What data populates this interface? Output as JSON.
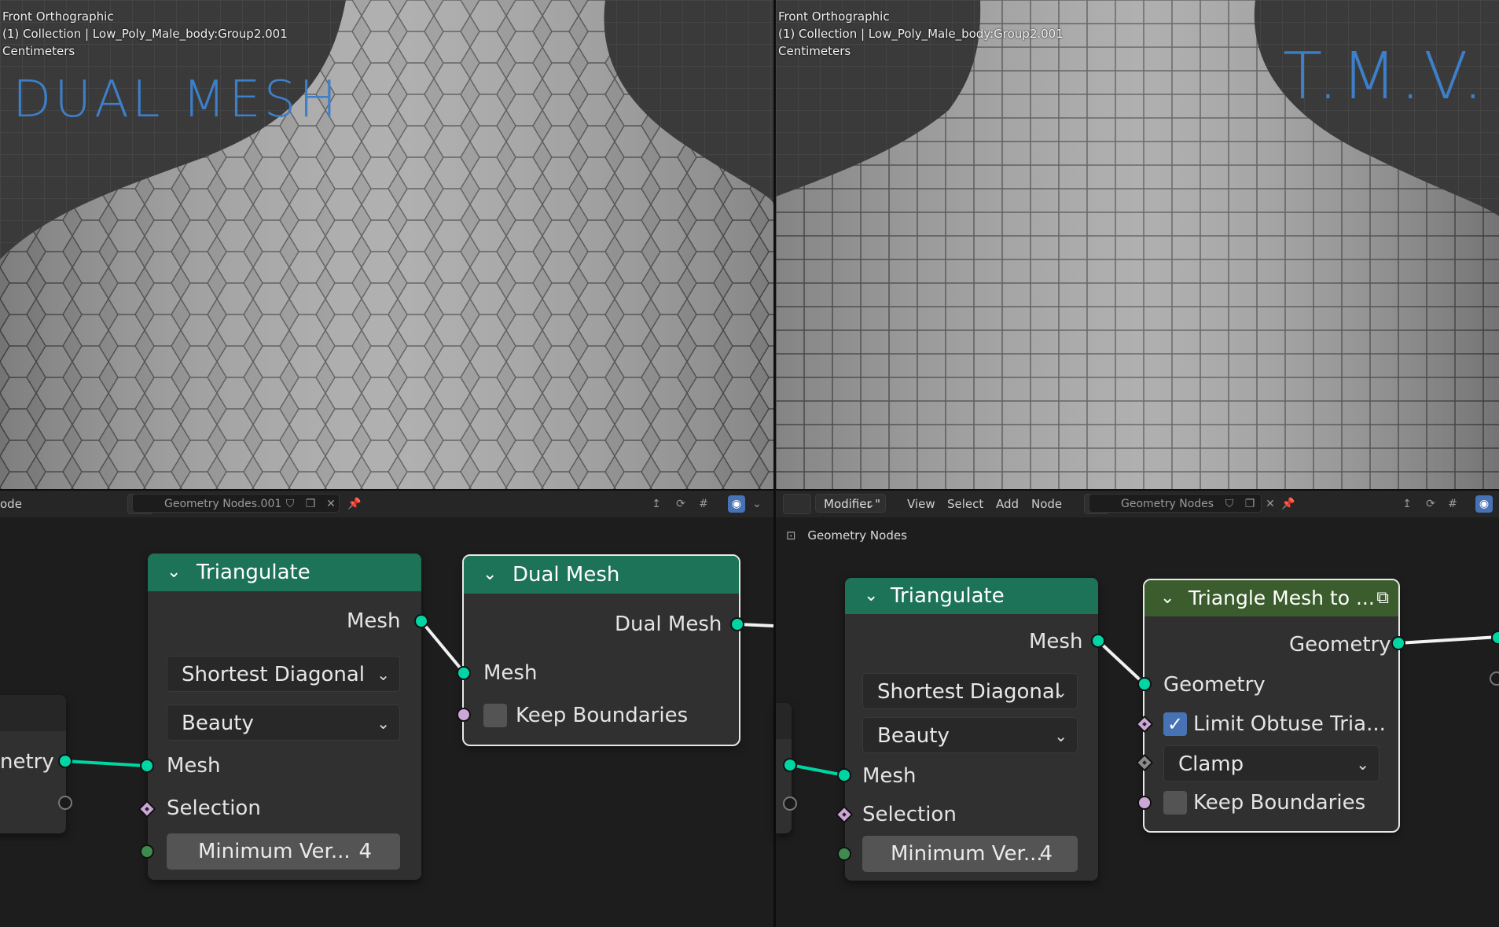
{
  "viewport_left": {
    "view_name": "Front Orthographic",
    "collection": "(1) Collection | Low_Poly_Male_body:Group2.001",
    "units": "Centimeters",
    "annotation": "DUAL MESH"
  },
  "viewport_right": {
    "view_name": "Front Orthographic",
    "collection": "(1) Collection | Low_Poly_Male_body:Group2.001",
    "units": "Centimeters",
    "annotation": "T.M.V."
  },
  "header_left": {
    "editor_label": "ode",
    "nodegroup_name": "Geometry Nodes.001"
  },
  "header_right": {
    "context": "Modifier",
    "menu": [
      "View",
      "Select",
      "Add",
      "Node"
    ],
    "nodegroup_name": "Geometry Nodes"
  },
  "breadcrumb": "Geometry Nodes",
  "left_editor": {
    "partial_node_output": "netry",
    "triangulate": {
      "title": "Triangulate",
      "output_mesh": "Mesh",
      "quad_method": "Shortest Diagonal",
      "ngon_method": "Beauty",
      "input_mesh": "Mesh",
      "selection": "Selection",
      "min_vertices_label": "Minimum Ver...",
      "min_vertices_value": "4"
    },
    "dual_mesh": {
      "title": "Dual Mesh",
      "output": "Dual Mesh",
      "input_mesh": "Mesh",
      "keep_boundaries": "Keep Boundaries"
    }
  },
  "right_editor": {
    "triangulate": {
      "title": "Triangulate",
      "output_mesh": "Mesh",
      "quad_method": "Shortest Diagonal",
      "ngon_method": "Beauty",
      "input_mesh": "Mesh",
      "selection": "Selection",
      "min_vertices_label": "Minimum Ver...",
      "min_vertices_value": "4"
    },
    "tmv": {
      "title": "Triangle Mesh to ...",
      "output": "Geometry",
      "input_geometry": "Geometry",
      "limit_obtuse": "Limit Obtuse Tria...",
      "limit_obtuse_checked": true,
      "clamp": "Clamp",
      "keep_boundaries": "Keep Boundaries"
    }
  },
  "colors": {
    "node_header_green": "#1d7358",
    "node_header_olive": "#3b5c2c",
    "socket_geometry": "#00d6a3",
    "socket_boolean": "#cca6d6",
    "accent_blue": "#4772b3"
  }
}
